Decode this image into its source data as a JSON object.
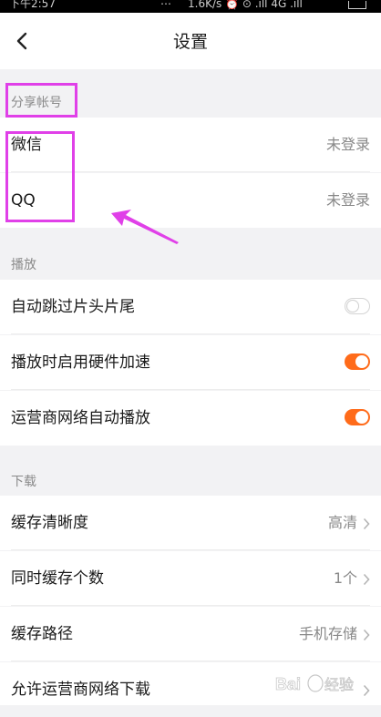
{
  "status_bar": {
    "time": "下午2:57",
    "dots": "…",
    "right": "1.6K/s ⏰ ⊙ .ıll 4G .ıll"
  },
  "nav": {
    "title": "设置",
    "back_icon": "chevron-left-icon"
  },
  "sections": {
    "share": {
      "header": "分享帐号",
      "rows": [
        {
          "label": "微信",
          "value": "未登录"
        },
        {
          "label": "QQ",
          "value": "未登录"
        }
      ]
    },
    "playback": {
      "header": "播放",
      "rows": [
        {
          "label": "自动跳过片头片尾",
          "toggle": false
        },
        {
          "label": "播放时启用硬件加速",
          "toggle": true
        },
        {
          "label": "运营商网络自动播放",
          "toggle": true
        }
      ]
    },
    "download": {
      "header": "下载",
      "rows": [
        {
          "label": "缓存清晰度",
          "value": "高清"
        },
        {
          "label": "同时缓存个数",
          "value": "1个"
        },
        {
          "label": "缓存路径",
          "value": "手机存储"
        },
        {
          "label": "允许运营商网络下载",
          "value": ""
        }
      ]
    }
  },
  "colors": {
    "accent": "#ff6b1a",
    "highlight": "#e040e8",
    "background": "#f2f2f4"
  },
  "watermark": "Baidu 经验"
}
